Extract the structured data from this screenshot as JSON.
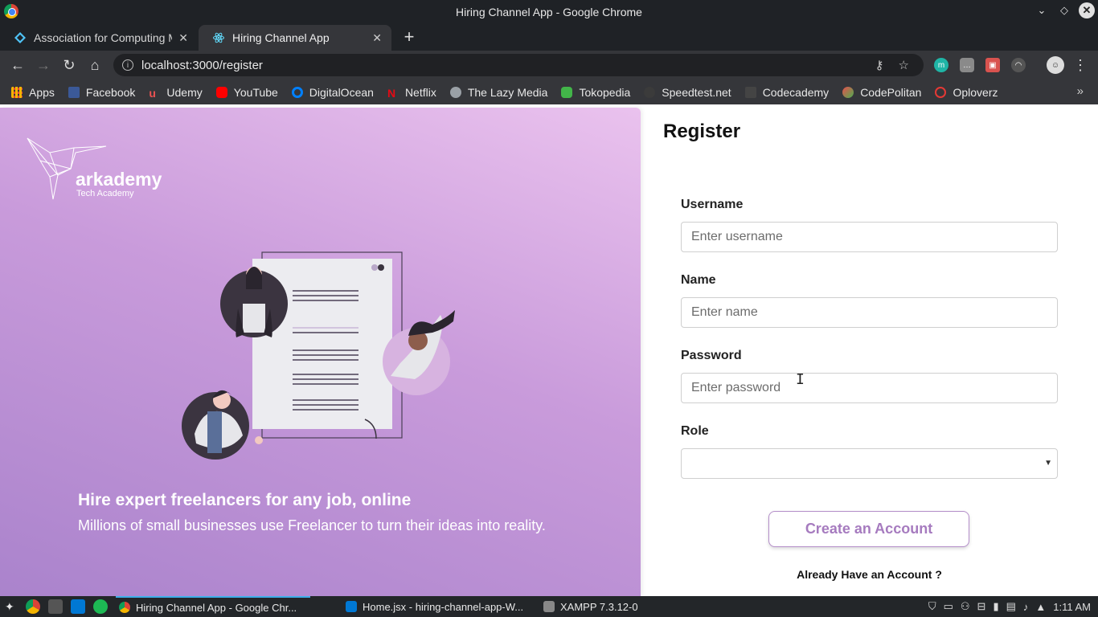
{
  "window": {
    "title": "Hiring Channel App - Google Chrome"
  },
  "tabs": [
    {
      "label": "Association for Computing M"
    },
    {
      "label": "Hiring Channel App"
    }
  ],
  "address_bar": {
    "url": "localhost:3000/register"
  },
  "bookmarks": [
    {
      "label": "Apps",
      "icon": "apps-grid-icon",
      "color": "#f4b400"
    },
    {
      "label": "Facebook",
      "icon": "facebook-icon",
      "color": "#3b5998"
    },
    {
      "label": "Udemy",
      "icon": "udemy-icon",
      "color": "#ec5252"
    },
    {
      "label": "YouTube",
      "icon": "youtube-icon",
      "color": "#ff0000"
    },
    {
      "label": "DigitalOcean",
      "icon": "digitalocean-icon",
      "color": "#0080ff"
    },
    {
      "label": "Netflix",
      "icon": "netflix-icon",
      "color": "#e50914"
    },
    {
      "label": "The Lazy Media",
      "icon": "globe-icon",
      "color": "#9aa0a6"
    },
    {
      "label": "Tokopedia",
      "icon": "tokopedia-icon",
      "color": "#42b549"
    },
    {
      "label": "Speedtest.net",
      "icon": "speedtest-icon",
      "color": "#3b3b3b"
    },
    {
      "label": "Codecademy",
      "icon": "codecademy-icon",
      "color": "#444444"
    },
    {
      "label": "CodePolitan",
      "icon": "codepolitan-icon",
      "color": "#e94e4e"
    },
    {
      "label": "Oploverz",
      "icon": "oploverz-icon",
      "color": "#e53935"
    }
  ],
  "hero": {
    "logo_text": "arkademy",
    "logo_sub": "Tech Academy",
    "title": "Hire expert freelancers for any job, online",
    "subtitle": "Millions of small businesses use Freelancer to turn their ideas into reality."
  },
  "form": {
    "title": "Register",
    "username": {
      "label": "Username",
      "placeholder": "Enter username",
      "value": ""
    },
    "name": {
      "label": "Name",
      "placeholder": "Enter name",
      "value": ""
    },
    "password": {
      "label": "Password",
      "placeholder": "Enter password",
      "value": ""
    },
    "role": {
      "label": "Role",
      "selected": ""
    },
    "submit_label": "Create an Account",
    "login_link": "Already Have an Account ?"
  },
  "taskbar": {
    "items": [
      {
        "label": "Hiring Channel App - Google Chr..."
      },
      {
        "label": "Home.jsx - hiring-channel-app-W..."
      },
      {
        "label": "XAMPP 7.3.12-0"
      }
    ],
    "clock": "1:11 AM"
  },
  "colors": {
    "accent": "#a67bbf",
    "hero_top": "#eac2ee",
    "hero_bottom": "#aa83cc"
  }
}
